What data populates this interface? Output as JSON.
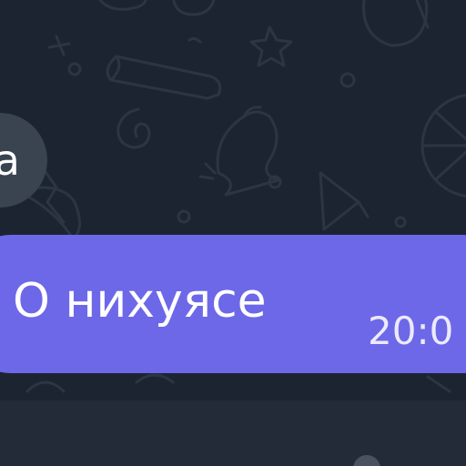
{
  "chat": {
    "sender_avatar_letter": "a",
    "message": {
      "text": "О нихуясе",
      "time": "20:0"
    }
  },
  "icons": {
    "background_pattern": "doodle-pattern",
    "bottom_indicator": "circle-icon"
  },
  "colors": {
    "chat_background": "#1c2431",
    "bubble": "#6d68e8",
    "avatar": "#3a4350",
    "bottom_bar": "#232b38"
  }
}
